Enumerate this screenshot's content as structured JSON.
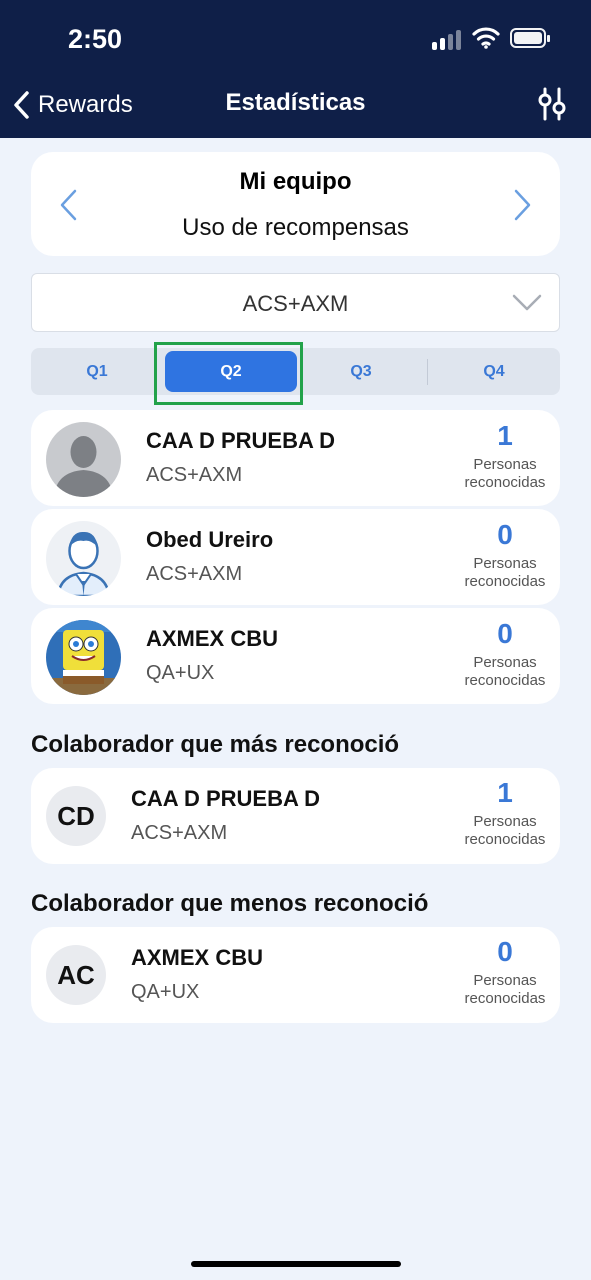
{
  "status": {
    "time": "2:50"
  },
  "nav": {
    "back_label": "Rewards",
    "title": "Estadísticas",
    "filter_icon": "sliders-icon"
  },
  "header": {
    "title": "Mi equipo",
    "subtitle": "Uso de recompensas"
  },
  "dropdown": {
    "value": "ACS+AXM"
  },
  "quarters": {
    "items": [
      "Q1",
      "Q2",
      "Q3",
      "Q4"
    ],
    "selected": "Q2"
  },
  "members": [
    {
      "name": "CAA D PRUEBA D",
      "team": "ACS+AXM",
      "count": "1",
      "label": "Personas reconocidas",
      "avatar": "silhouette-avatar"
    },
    {
      "name": "Obed Ureiro",
      "team": "ACS+AXM",
      "count": "0",
      "label": "Personas reconocidas",
      "avatar": "businessman-avatar"
    },
    {
      "name": "AXMEX CBU",
      "team": "QA+UX",
      "count": "0",
      "label": "Personas reconocidas",
      "avatar": "cartoon-avatar"
    }
  ],
  "most": {
    "title": "Colaborador que más reconoció",
    "initials": "CD",
    "name": "CAA D PRUEBA D",
    "team": "ACS+AXM",
    "count": "1",
    "label": "Personas reconocidas"
  },
  "least": {
    "title": "Colaborador que menos reconoció",
    "initials": "AC",
    "name": "AXMEX CBU",
    "team": "QA+UX",
    "count": "0",
    "label": "Personas reconocidas"
  },
  "colors": {
    "navy": "#0f1f48",
    "accent": "#2f74e1",
    "background": "#eef3fb",
    "highlight": "#22a24a"
  }
}
